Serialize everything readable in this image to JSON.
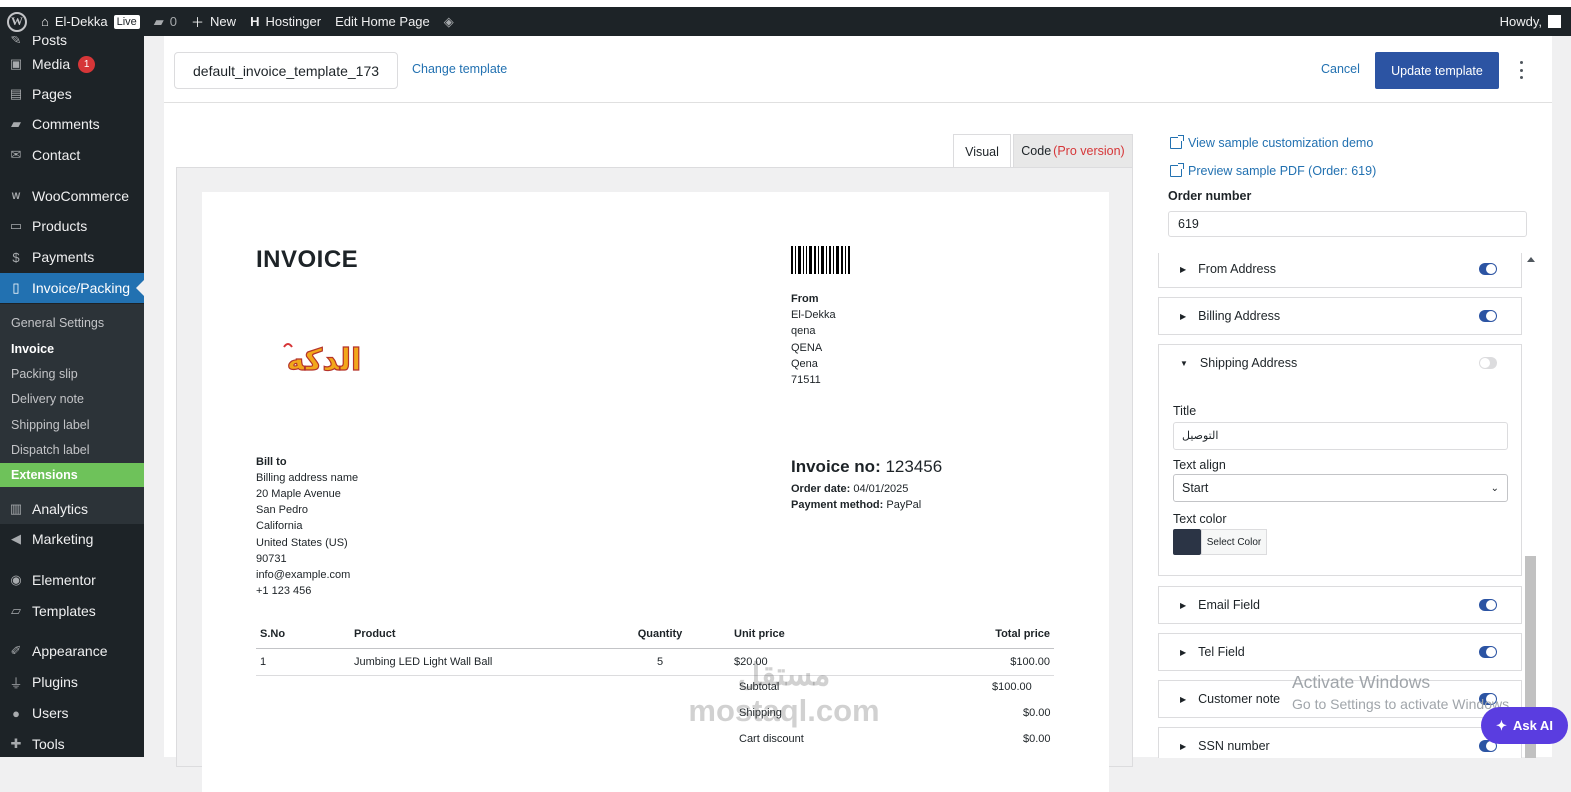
{
  "admin_bar": {
    "site_name": "El-Dekka",
    "live_badge": "Live",
    "comments_count": "0",
    "new_label": "New",
    "hostinger_label": "Hostinger",
    "edit_page_label": "Edit Home Page",
    "howdy": "Howdy,"
  },
  "sidebar": {
    "items": [
      {
        "label": "Posts",
        "icon": "pushpin-icon"
      },
      {
        "label": "Media",
        "icon": "media-icon",
        "badge": "1"
      },
      {
        "label": "Pages",
        "icon": "pages-icon"
      },
      {
        "label": "Comments",
        "icon": "comment-icon"
      },
      {
        "label": "Contact",
        "icon": "mail-icon"
      },
      {
        "label": "WooCommerce",
        "icon": "woo-icon"
      },
      {
        "label": "Products",
        "icon": "archive-icon"
      },
      {
        "label": "Payments",
        "icon": "dollar-icon"
      },
      {
        "label": "Invoice/Packing",
        "icon": "document-icon"
      },
      {
        "label": "Analytics",
        "icon": "chart-icon"
      },
      {
        "label": "Marketing",
        "icon": "megaphone-icon"
      },
      {
        "label": "Elementor",
        "icon": "elementor-icon"
      },
      {
        "label": "Templates",
        "icon": "folder-icon"
      },
      {
        "label": "Appearance",
        "icon": "brush-icon"
      },
      {
        "label": "Plugins",
        "icon": "plug-icon"
      },
      {
        "label": "Users",
        "icon": "user-icon"
      },
      {
        "label": "Tools",
        "icon": "wrench-icon"
      }
    ],
    "submenu": [
      "General Settings",
      "Invoice",
      "Packing slip",
      "Delivery note",
      "Shipping label",
      "Dispatch label",
      "Extensions"
    ]
  },
  "header": {
    "template_name": "default_invoice_template_173",
    "change_template": "Change template",
    "cancel": "Cancel",
    "update": "Update template"
  },
  "tabs": {
    "visual": "Visual",
    "code": "Code",
    "code_pro": "(Pro version)"
  },
  "invoice": {
    "title": "INVOICE",
    "from_label": "From",
    "from_lines": [
      "El-Dekka",
      "qena",
      "QENA",
      "Qena",
      "71511"
    ],
    "bill_to_label": "Bill to",
    "bill_lines": [
      "Billing address name",
      "20 Maple Avenue",
      "San Pedro",
      "California",
      "United States (US)",
      "90731",
      "info@example.com",
      "+1 123 456"
    ],
    "invoice_no_label": "Invoice no:",
    "invoice_no": "123456",
    "order_date_label": "Order date:",
    "order_date": "04/01/2025",
    "payment_label": "Payment method:",
    "payment": "PayPal",
    "logo_text": "الدكه",
    "table_headers": [
      "S.No",
      "Product",
      "Quantity",
      "Unit price",
      "Total price"
    ],
    "rows": [
      {
        "sno": "1",
        "product": "Jumbing LED Light Wall Ball",
        "qty": "5",
        "unit": "$20.00",
        "total": "$100.00"
      }
    ],
    "subtotal_label": "Subtotal",
    "subtotal": "$100.00",
    "shipping_label": "Shipping",
    "shipping": "$0.00",
    "discount_label": "Cart discount",
    "discount": "$0.00"
  },
  "right_panel": {
    "view_demo": "View sample customization demo",
    "preview_pdf": "Preview sample PDF (Order: 619)",
    "order_number_label": "Order number",
    "order_number": "619"
  },
  "sections": [
    {
      "label": "From Address",
      "enabled": true
    },
    {
      "label": "Billing Address",
      "enabled": true
    },
    {
      "label": "Shipping Address",
      "enabled": false,
      "expanded": true
    },
    {
      "label": "Email Field",
      "enabled": true
    },
    {
      "label": "Tel Field",
      "enabled": true
    },
    {
      "label": "Customer note",
      "enabled": true
    },
    {
      "label": "SSN number",
      "enabled": true
    }
  ],
  "shipping_settings": {
    "title_label": "Title",
    "title_value": "التوصيل",
    "align_label": "Text align",
    "align_value": "Start",
    "color_label": "Text color",
    "color_value": "#2b3445",
    "color_button": "Select Color"
  },
  "overlays": {
    "activate_windows": "Activate Windows",
    "activate_sub": "Go to Settings to activate Windows.",
    "mostaql_ar": "مستقل",
    "mostaql_en": "mostaql.com",
    "ask_ai": "Ask AI"
  }
}
